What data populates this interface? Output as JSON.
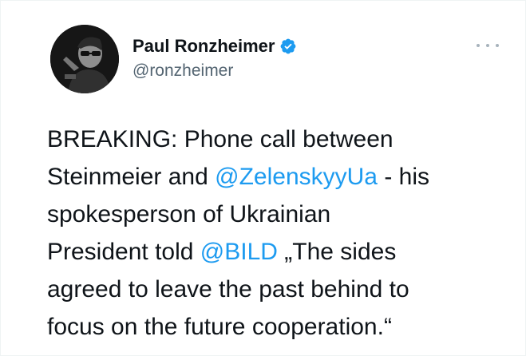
{
  "author": {
    "name": "Paul Ronzheimer",
    "handle": "@ronzheimer",
    "verified": true
  },
  "tweet": {
    "lines": [
      {
        "segments": [
          {
            "text": "BREAKING: Phone call between",
            "type": "text"
          }
        ]
      },
      {
        "segments": [
          {
            "text": "Steinmeier and ",
            "type": "text"
          },
          {
            "text": "@ZelenskyyUa",
            "type": "mention"
          },
          {
            "text": " - his",
            "type": "text"
          }
        ]
      },
      {
        "segments": [
          {
            "text": "spokesperson of Ukrainian",
            "type": "text"
          }
        ]
      },
      {
        "segments": [
          {
            "text": "President told ",
            "type": "text"
          },
          {
            "text": "@BILD",
            "type": "mention"
          },
          {
            "text": " „The sides",
            "type": "text"
          }
        ]
      },
      {
        "segments": [
          {
            "text": "agreed to leave the past behind to",
            "type": "text"
          }
        ]
      },
      {
        "segments": [
          {
            "text": "focus on the future cooperation.“",
            "type": "text"
          }
        ]
      }
    ]
  },
  "icons": {
    "verified": "verified-badge-icon",
    "more": "more-options-icon"
  },
  "colors": {
    "text": "#0f1419",
    "secondary": "#536471",
    "link": "#1d9bf0",
    "verified": "#1d9bf0"
  }
}
